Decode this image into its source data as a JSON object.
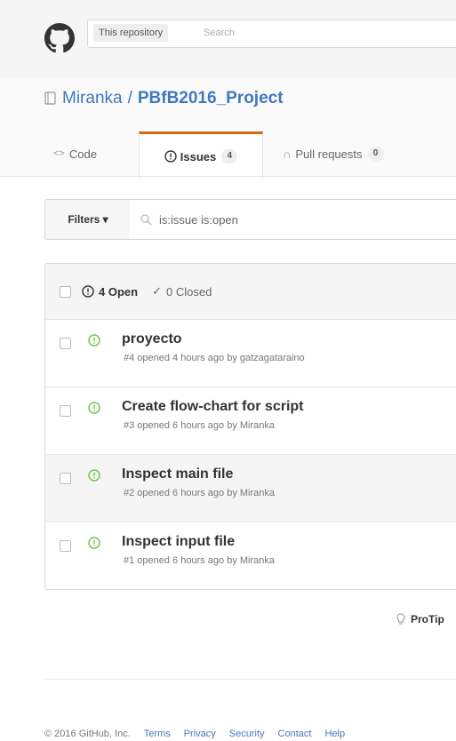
{
  "header": {
    "scope_label": "This repository",
    "search_placeholder": "Search"
  },
  "repo": {
    "owner": "Miranka",
    "separator": "/",
    "name": "PBfB2016_Project"
  },
  "tabs": [
    {
      "icon": "code-icon",
      "label": "Code"
    },
    {
      "icon": "issue-opened-icon",
      "label": "Issues",
      "count": "4",
      "selected": true
    },
    {
      "icon": "git-pull-request-icon",
      "label": "Pull requests",
      "count": "0"
    }
  ],
  "filters": {
    "button_label": "Filters ▾",
    "query": "is:issue is:open"
  },
  "issues_header": {
    "open_label": "4 Open",
    "closed_label": "0 Closed"
  },
  "issues": [
    {
      "title": "proyecto",
      "meta": "#4 opened 4 hours ago by gatzagataraino"
    },
    {
      "title": "Create flow-chart for script",
      "meta": "#3 opened 6 hours ago by Miranka"
    },
    {
      "title": "Inspect main file",
      "meta": "#2 opened 6 hours ago by Miranka"
    },
    {
      "title": "Inspect input file",
      "meta": "#1 opened 6 hours ago by Miranka"
    }
  ],
  "protip": "ProTip",
  "footer": {
    "copyright": "© 2016 GitHub, Inc.",
    "links": [
      "Terms",
      "Privacy",
      "Security",
      "Contact",
      "Help"
    ]
  },
  "colors": {
    "link": "#4078c0",
    "open_green": "#6cc644",
    "selected_tab_accent": "#d26911"
  }
}
